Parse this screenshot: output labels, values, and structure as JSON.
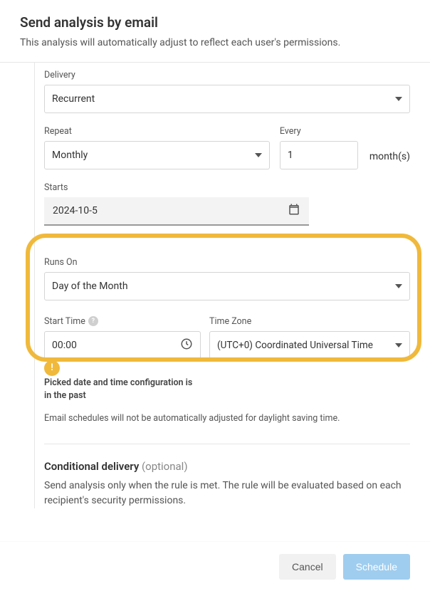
{
  "header": {
    "title": "Send analysis by email",
    "subtitle": "This analysis will automatically adjust to reflect each user's permissions."
  },
  "delivery": {
    "label": "Delivery",
    "value": "Recurrent"
  },
  "repeat": {
    "label": "Repeat",
    "value": "Monthly"
  },
  "every": {
    "label": "Every",
    "value": "1",
    "unit": "month(s)"
  },
  "starts": {
    "label": "Starts",
    "value": "2024-10-5"
  },
  "runsOn": {
    "label": "Runs On",
    "value": "Day of the Month"
  },
  "startTime": {
    "label": "Start Time",
    "value": "00:00"
  },
  "timeZone": {
    "label": "Time Zone",
    "value": "(UTC+0) Coordinated Universal Time"
  },
  "warning": {
    "line1": "Picked date and time configuration is",
    "line2": "in the past"
  },
  "info": "Email schedules will not be automatically adjusted for daylight saving time.",
  "conditional": {
    "title": "Conditional delivery",
    "optional": "(optional)",
    "desc": "Send analysis only when the rule is met. The rule will be evaluated based on each recipient's security permissions."
  },
  "footer": {
    "cancel": "Cancel",
    "schedule": "Schedule"
  }
}
